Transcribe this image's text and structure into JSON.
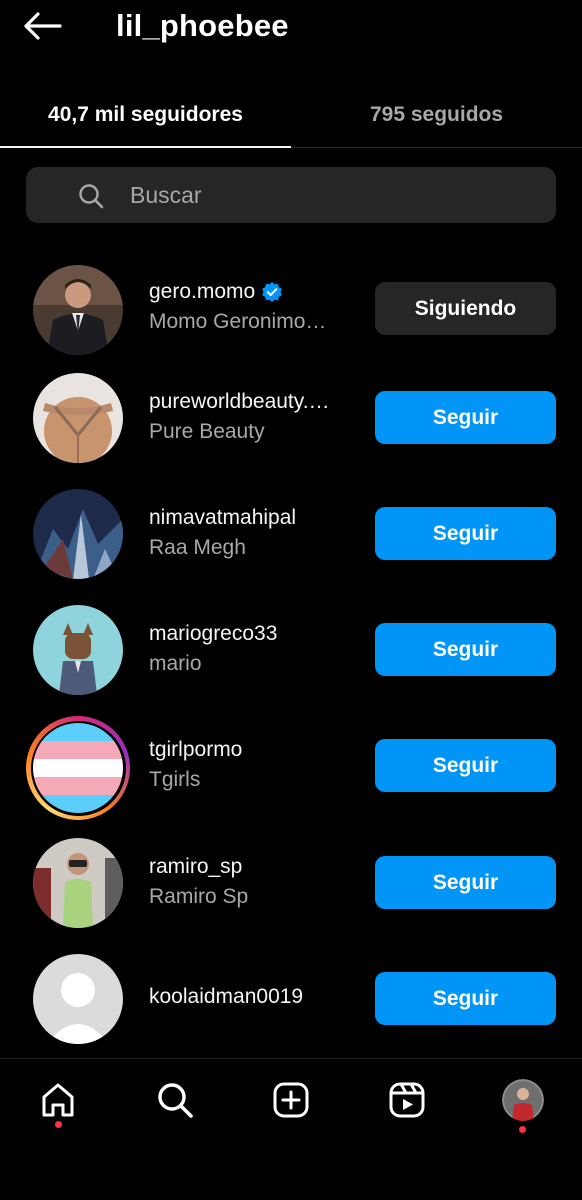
{
  "header": {
    "title": "lil_phoebee",
    "back_icon": "arrow-left-icon"
  },
  "tabs": [
    {
      "label": "40,7 mil seguidores",
      "active": true
    },
    {
      "label": "795 seguidos",
      "active": false
    }
  ],
  "search": {
    "placeholder": "Buscar",
    "value": ""
  },
  "accounts": [
    {
      "username": "gero.momo",
      "full_name": "Momo Geronimo…",
      "verified": true,
      "button": "Siguiendo"
    },
    {
      "username": "pureworldbeauty.…",
      "full_name": "Pure Beauty",
      "verified": false,
      "button": "Seguir"
    },
    {
      "username": "nimavatmahipal",
      "full_name": "Raa Megh",
      "verified": false,
      "button": "Seguir"
    },
    {
      "username": "mariogreco33",
      "full_name": "mario",
      "verified": false,
      "button": "Seguir"
    },
    {
      "username": "tgirlpormo",
      "full_name": "Tgirls",
      "verified": false,
      "button": "Seguir",
      "story_ring": true
    },
    {
      "username": "ramiro_sp",
      "full_name": "Ramiro Sp",
      "verified": false,
      "button": "Seguir"
    },
    {
      "username": "koolaidman0019",
      "full_name": "",
      "verified": false,
      "button": "Seguir"
    }
  ],
  "bottom_nav": [
    {
      "icon": "home-icon",
      "notification_dot": true
    },
    {
      "icon": "search-icon",
      "notification_dot": false
    },
    {
      "icon": "create-post-icon",
      "notification_dot": false
    },
    {
      "icon": "reels-icon",
      "notification_dot": false
    },
    {
      "icon": "profile-avatar",
      "notification_dot": true
    }
  ],
  "colors": {
    "background": "#000000",
    "follow_button": "#0095f6",
    "following_button": "#262626",
    "secondary_text": "#a8a8a8",
    "verified_badge": "#0095f6",
    "notification_dot": "#ff3040"
  }
}
